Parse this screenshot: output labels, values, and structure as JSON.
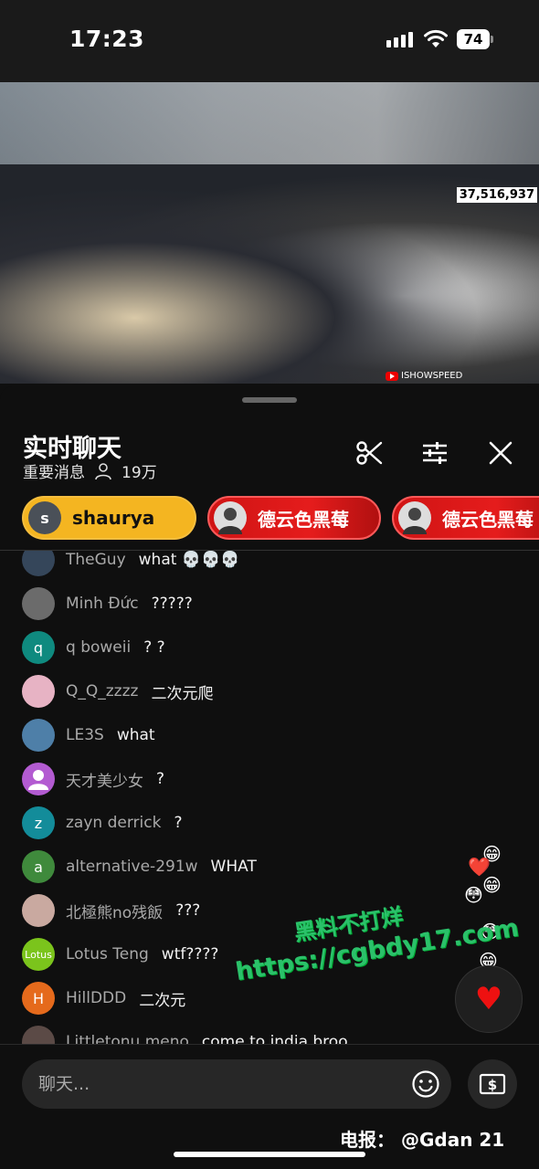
{
  "status_bar": {
    "time": "17:23",
    "battery": "74"
  },
  "video": {
    "viewer_count": "37,516,937",
    "channel_watermark": "ISHOWSPEED"
  },
  "chat_header": {
    "title": "实时聊天",
    "mode": "重要消息",
    "viewers": "19万"
  },
  "pinned": [
    {
      "avatar_letter": "s",
      "name": "shaurya",
      "style": "gold"
    },
    {
      "avatar_letter": "",
      "name": "德云色黑莓",
      "style": "red"
    },
    {
      "avatar_letter": "",
      "name": "德云色黑莓",
      "style": "red"
    }
  ],
  "messages": [
    {
      "user": "TheGuy",
      "text": "what 💀💀💀",
      "avatar": "",
      "avatar_color": "#35465a"
    },
    {
      "user": "Minh Đức",
      "text": "?????",
      "avatar": "",
      "avatar_color": "#6b6b6b"
    },
    {
      "user": "q boweii",
      "text": "? ?",
      "avatar": "q",
      "avatar_color": "#0f8a7f"
    },
    {
      "user": "Q_Q_zzzz",
      "text": "二次元爬",
      "avatar": "",
      "avatar_color": "#e7b3c4"
    },
    {
      "user": "LE3S",
      "text": "what",
      "avatar": "",
      "avatar_color": "#4e7fa8"
    },
    {
      "user": "天才美少女",
      "text": "?",
      "avatar": "",
      "avatar_color": "#b35bd1"
    },
    {
      "user": "zayn derrick",
      "text": "?",
      "avatar": "z",
      "avatar_color": "#138c9a"
    },
    {
      "user": "alternative-291w",
      "text": "WHAT",
      "avatar": "a",
      "avatar_color": "#3f8a3c"
    },
    {
      "user": "北極熊no残飯",
      "text": "???",
      "avatar": "",
      "avatar_color": "#c9a9a0"
    },
    {
      "user": "Lotus Teng",
      "text": "wtf????",
      "avatar": "Lotus",
      "avatar_color": "#7bc41c"
    },
    {
      "user": "HillDDD",
      "text": "二次元",
      "avatar": "H",
      "avatar_color": "#e56a1c"
    },
    {
      "user": "Littletonu meno",
      "text": "come to india broo",
      "avatar": "",
      "avatar_color": "#5b4a46"
    }
  ],
  "reactions": [
    "😁",
    "❤️",
    "😁",
    "😳",
    "😳",
    "😁"
  ],
  "watermark": {
    "line1": "黑料不打烊",
    "line2": "https://cgbdy17.com"
  },
  "composer": {
    "placeholder": "聊天..."
  },
  "telegram": "电报：  @Gdan 21",
  "colors": {
    "accent_gold": "#f4b521",
    "accent_red": "#e01b1b",
    "background": "#0f0f0f",
    "watermark_green": "#2bc16a"
  },
  "icons": {
    "clip": "scissors-icon",
    "filter": "sliders-icon",
    "close": "close-icon",
    "emoji": "emoji-icon",
    "super_chat": "money-icon",
    "like": "heart-icon"
  }
}
